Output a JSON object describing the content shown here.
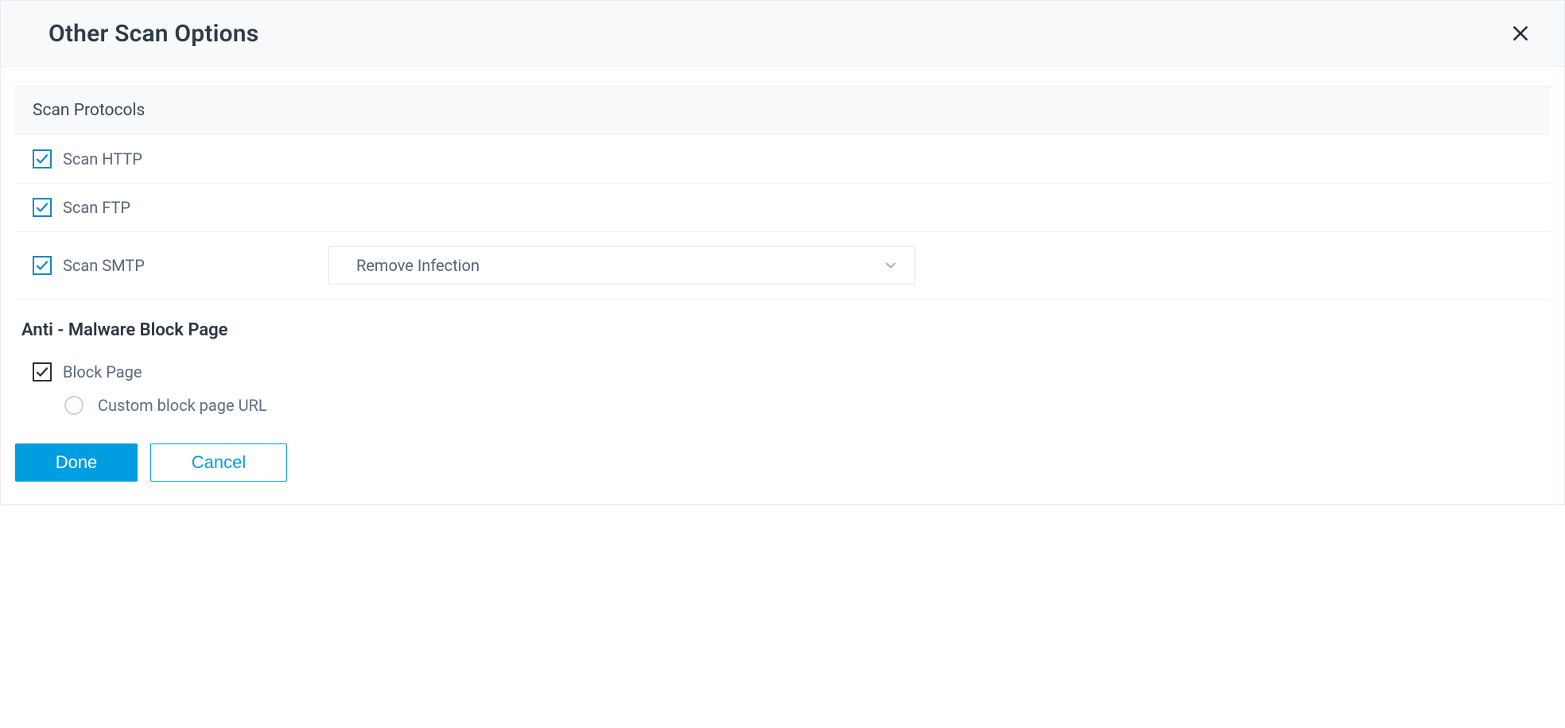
{
  "header": {
    "title": "Other Scan Options"
  },
  "sections": {
    "scan_protocols": {
      "title": "Scan Protocols",
      "http": {
        "label": "Scan HTTP",
        "checked": true
      },
      "ftp": {
        "label": "Scan FTP",
        "checked": true
      },
      "smtp": {
        "label": "Scan SMTP",
        "checked": true,
        "action": {
          "selected": "Remove Infection"
        }
      }
    },
    "anti_malware": {
      "title": "Anti - Malware Block Page",
      "block_page": {
        "label": "Block Page",
        "checked": true
      },
      "custom_url": {
        "label": "Custom block page URL",
        "selected": false
      }
    }
  },
  "footer": {
    "done": "Done",
    "cancel": "Cancel"
  },
  "colors": {
    "accent": "#009de0",
    "checkbox_border": "#0f88c9",
    "text_muted": "#59667a"
  }
}
